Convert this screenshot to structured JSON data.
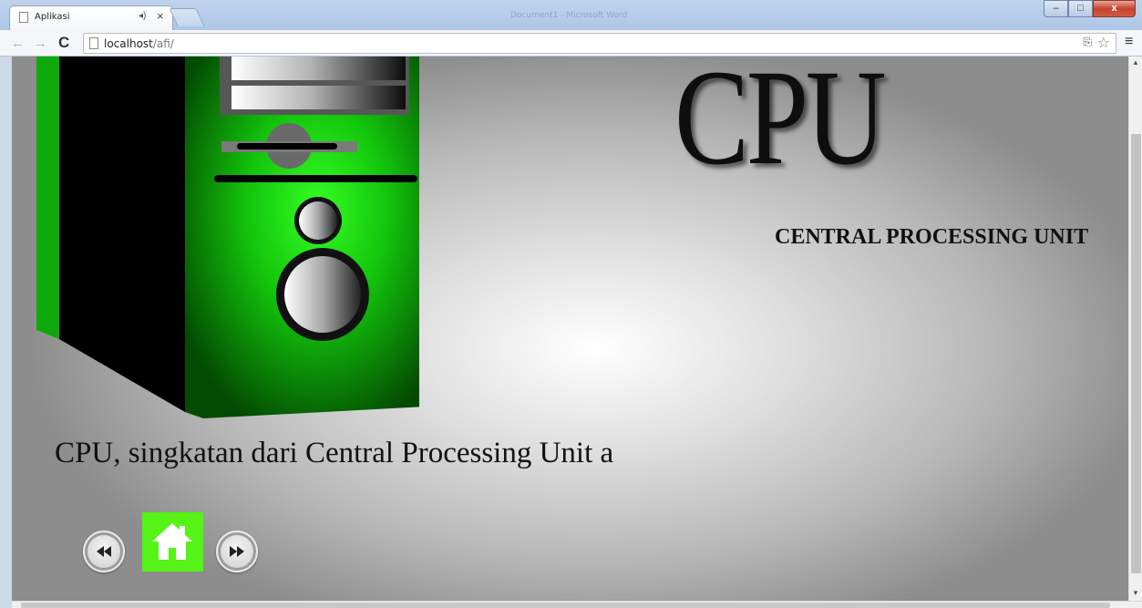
{
  "browser": {
    "tab_title": "Aplikasi",
    "background_window_title": "Document1 - Microsoft Word",
    "url_host": "localhost",
    "url_path": "/afi/",
    "window_controls": {
      "minimize": "–",
      "maximize": "□",
      "close": "x"
    }
  },
  "page": {
    "heading": "CPU",
    "subheading": "CENTRAL PROCESSING UNIT",
    "description": "CPU, singkatan dari Central Processing Unit a"
  },
  "navigation": {
    "prev_icon": "rewind-icon",
    "home_icon": "home-icon",
    "next_icon": "fast-forward-icon"
  },
  "colors": {
    "case_green": "#1fd61b",
    "home_button": "#55f316",
    "case_black": "#000000"
  }
}
